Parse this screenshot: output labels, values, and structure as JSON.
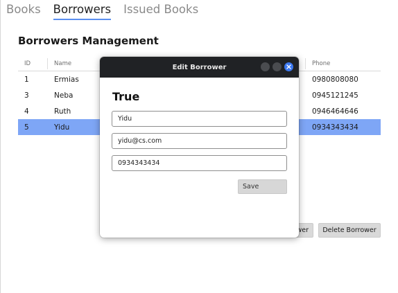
{
  "tabs": [
    {
      "label": "Books",
      "active": false
    },
    {
      "label": "Borrowers",
      "active": true
    },
    {
      "label": "Issued Books",
      "active": false
    }
  ],
  "page": {
    "heading": "Borrowers Management"
  },
  "table": {
    "headers": {
      "id": "ID",
      "name": "Name",
      "phone": "Phone"
    },
    "rows": [
      {
        "id": "1",
        "name": "Ermias",
        "phone": "0980808080"
      },
      {
        "id": "3",
        "name": "Neba",
        "phone": "0945121245"
      },
      {
        "id": "4",
        "name": "Ruth",
        "phone": "0946464646"
      },
      {
        "id": "5",
        "name": "Yidu",
        "phone": "0934343434"
      }
    ],
    "selected_row": 3
  },
  "actions": {
    "button_a": "",
    "button_b": "wer",
    "delete": "Delete Borrower"
  },
  "dialog": {
    "title": "Edit Borrower",
    "status_text": "True",
    "name_value": "Yidu",
    "email_value": "yidu@cs.com",
    "phone_value": "0934343434",
    "save_label": "Save"
  },
  "colors": {
    "accent": "#5a8ef0",
    "selected_row": "#7ea6f6",
    "titlebar": "#202225",
    "close_button": "#3b78f0"
  }
}
